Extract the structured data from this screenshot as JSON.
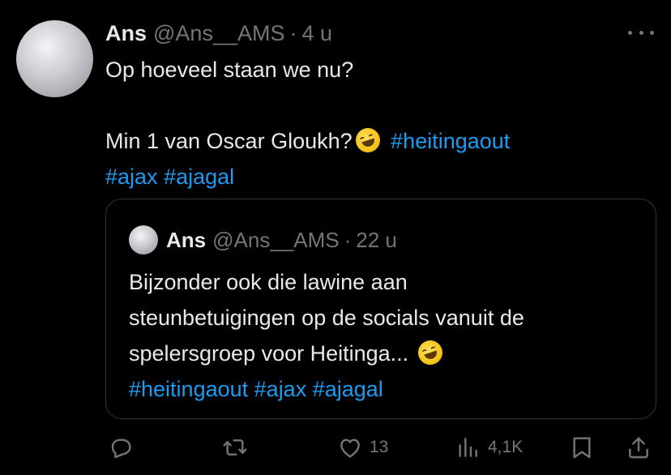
{
  "tweet": {
    "name": "Ans",
    "handle": "@Ans__AMS",
    "separator": "·",
    "time": "4 u",
    "lines": [
      "Op hoeveel staan we nu?",
      "Min 1 van Oscar Gloukh?"
    ],
    "hashtags_line2": "#heitingaout",
    "hashtags_line3": [
      "#ajax",
      "#ajagal"
    ]
  },
  "quote": {
    "name": "Ans",
    "handle": "@Ans__AMS",
    "separator": "·",
    "time": "22 u",
    "lines": [
      "Bijzonder ook die lawine aan",
      "steunbetuigingen op de socials vanuit de",
      "spelersgroep voor Heitinga..."
    ],
    "hashtags": [
      "#heitingaout",
      "#ajax",
      "#ajagal"
    ]
  },
  "actions": {
    "reply_icon": "reply-icon",
    "retweet_icon": "retweet-icon",
    "like_icon": "heart-icon",
    "likes": "13",
    "views_icon": "views-icon",
    "views": "4,1K",
    "bookmark_icon": "bookmark-icon",
    "share_icon": "share-icon"
  },
  "colors": {
    "background": "#000000",
    "text": "#e7e9ea",
    "muted": "#71767b",
    "link": "#1d9bf0",
    "border": "#2f3336"
  }
}
